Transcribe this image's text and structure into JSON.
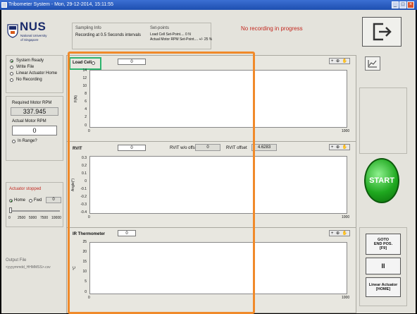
{
  "window": {
    "title": "Tribometer System - Mon, 29-12-2014, 15:11:55"
  },
  "logo": {
    "name": "NUS",
    "sub1": "National University",
    "sub2": "of Singapore"
  },
  "sampling": {
    "heading": "Sampling Info",
    "text": "Recording at 0.5 Seconds intervals"
  },
  "setpoints": {
    "heading": "Set-points",
    "line1": "Load Cell Set-Point.... 0 N",
    "line2": "Actual Motor RPM Set-Point.... +/- 25 %"
  },
  "status": {
    "recording": "No recording in progress"
  },
  "statuslist": [
    "System Ready",
    "Write File",
    "Linear Actuator Home",
    "No Recording"
  ],
  "motor": {
    "required_label": "Required Motor RPM",
    "required_value": "337.945",
    "actual_label": "Actual Motor RPM",
    "actual_value": "0",
    "inrange_label": "In Range?"
  },
  "actuator": {
    "stopped": "Actuator stopped",
    "home": "Home",
    "fwd": "Fwd",
    "fwd_value": "0",
    "slider_ticks": [
      "0",
      "2500",
      "5000",
      "7500",
      "10000"
    ]
  },
  "output": {
    "label": "Output File",
    "value": "<yyyymmdd_HHMMSS>.csv"
  },
  "charts": {
    "load": {
      "title": "Load Cell",
      "value": "0",
      "ylabel": "F(N)",
      "yticks": [
        "14",
        "12",
        "10",
        "8",
        "6",
        "4",
        "2",
        "0"
      ],
      "xmin": "0",
      "xmax": "1000"
    },
    "rvit": {
      "title": "RVIT",
      "value": "0",
      "nowoffset_label": "RVIT w/o offset",
      "nowoffset_value": "0",
      "offset_label": "RVIT offset",
      "offset_value": "4.6283",
      "ylabel": "Angle(°)",
      "yticks": [
        "0.3",
        "0.2",
        "0.1",
        "0",
        "-0.1",
        "-0.2",
        "-0.3",
        "-0.4"
      ],
      "xmin": "0",
      "xmax": "1000"
    },
    "ir": {
      "title": "IR Thermometer",
      "value": "0",
      "ylabel": "°C",
      "yticks": [
        "25",
        "20",
        "15",
        "10",
        "5",
        "0"
      ],
      "xmin": "0",
      "xmax": "1000"
    }
  },
  "buttons": {
    "start": "START",
    "goto1": "GOTO",
    "goto2": "END POS.",
    "goto3": "[F9]",
    "pause": "II",
    "linear1": "Linear Actuator",
    "linear2": "[HOME]",
    "tools": "+ ⊕ ✋"
  },
  "window_buttons": {
    "min": "_",
    "max": "□",
    "close": "×"
  }
}
